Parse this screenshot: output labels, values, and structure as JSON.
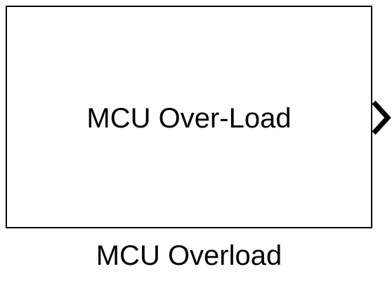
{
  "block": {
    "label": "MCU Over-Load",
    "name": "MCU Overload",
    "port_icon": "chevron-right-icon",
    "border_color": "#000000",
    "background_color": "#ffffff"
  }
}
